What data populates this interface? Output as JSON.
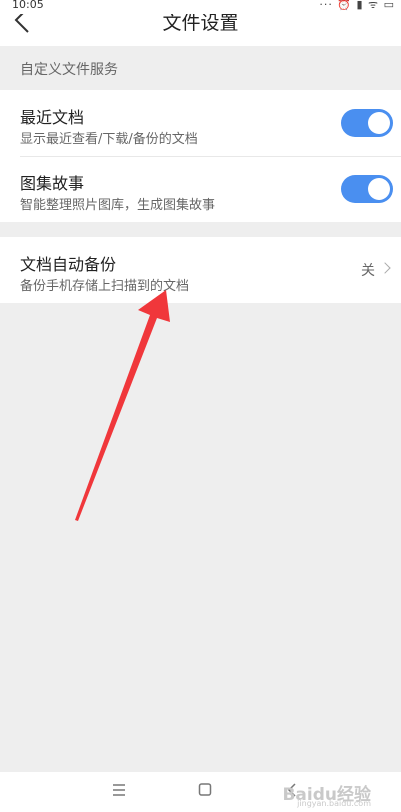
{
  "status": {
    "time": "10:05",
    "icons": "··· ⏰ ▮ ᯤ ▭"
  },
  "header": {
    "title": "文件设置"
  },
  "section": {
    "label": "自定义文件服务"
  },
  "settings": [
    {
      "title": "最近文档",
      "subtitle": "显示最近查看/下载/备份的文档",
      "toggle_on": true
    },
    {
      "title": "图集故事",
      "subtitle": "智能整理照片图库，生成图集故事",
      "toggle_on": true
    }
  ],
  "backup": {
    "title": "文档自动备份",
    "subtitle": "备份手机存储上扫描到的文档",
    "value": "关"
  },
  "colors": {
    "accent": "#4a8ff0",
    "annotation_arrow": "#f0373b"
  },
  "watermark": {
    "text": "Baidu经验",
    "sub": "jingyan.baidu.com"
  }
}
